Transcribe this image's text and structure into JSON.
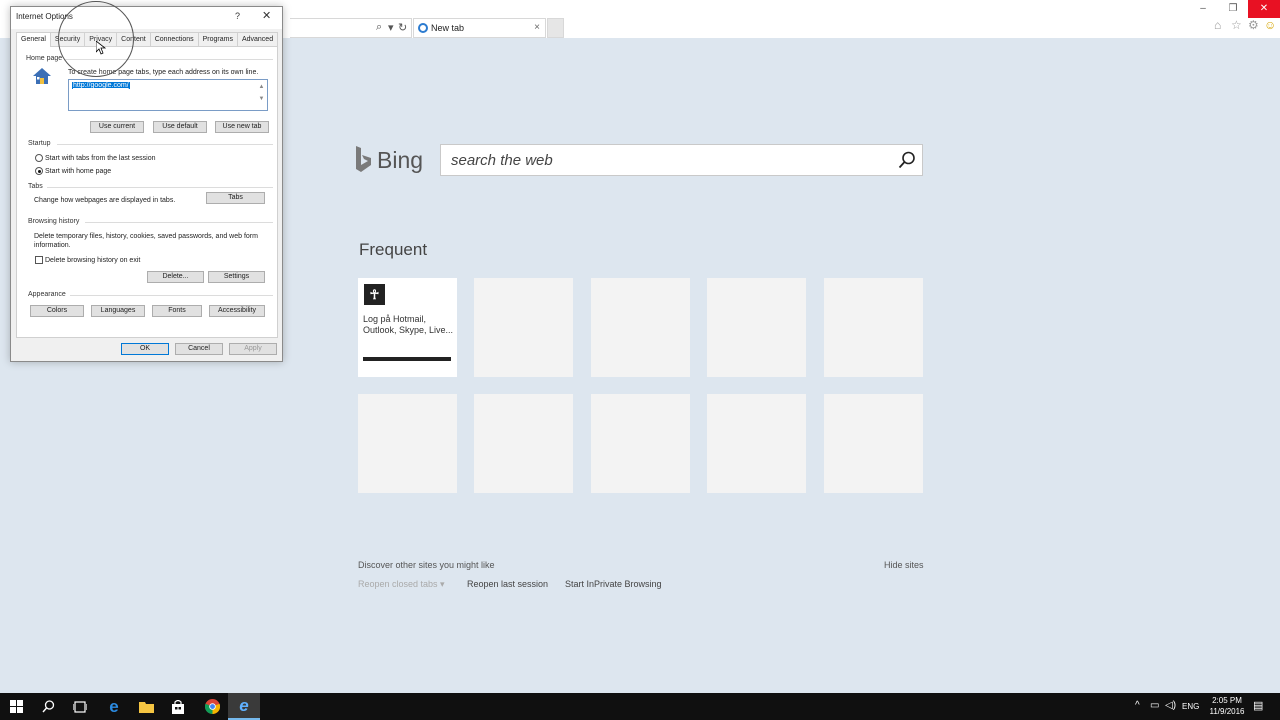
{
  "browser": {
    "tab_title": "New tab",
    "tab_close": "×",
    "window_controls": {
      "minimize": "–",
      "restore": "❐",
      "close": "✕"
    }
  },
  "bing": {
    "logo_text": "Bing",
    "search_placeholder": "search the web"
  },
  "frequent": {
    "title": "Frequent",
    "tiles": [
      {
        "label": "Log på Hotmail, Outlook, Skype, Live..."
      }
    ]
  },
  "footer": {
    "discover": "Discover other sites you might like",
    "hide_sites": "Hide sites",
    "reopen_closed": "Reopen closed tabs ▾",
    "reopen_last": "Reopen last session",
    "inprivate": "Start InPrivate Browsing"
  },
  "dialog": {
    "title": "Internet Options",
    "help": "?",
    "close": "✕",
    "tabs": [
      "General",
      "Security",
      "Privacy",
      "Content",
      "Connections",
      "Programs",
      "Advanced"
    ],
    "home_page": {
      "heading": "Home page",
      "instruction": "To create home page tabs, type each address on its own line.",
      "value": "http://google.com/",
      "buttons": {
        "use_current": "Use current",
        "use_default": "Use default",
        "use_new_tab": "Use new tab"
      }
    },
    "startup": {
      "heading": "Startup",
      "option_last_session": "Start with tabs from the last session",
      "option_home_page": "Start with home page",
      "selected": "home_page"
    },
    "tabs_section": {
      "heading": "Tabs",
      "description": "Change how webpages are displayed in tabs.",
      "button": "Tabs"
    },
    "browsing_history": {
      "heading": "Browsing history",
      "description": "Delete temporary files, history, cookies, saved passwords, and web form information.",
      "checkbox_label": "Delete browsing history on exit",
      "checkbox_checked": false,
      "delete_button": "Delete...",
      "settings_button": "Settings"
    },
    "appearance": {
      "heading": "Appearance",
      "buttons": {
        "colors": "Colors",
        "languages": "Languages",
        "fonts": "Fonts",
        "accessibility": "Accessibility"
      }
    },
    "footer_buttons": {
      "ok": "OK",
      "cancel": "Cancel",
      "apply": "Apply"
    }
  },
  "taskbar": {
    "language": "ENG",
    "time": "2:05 PM",
    "date": "11/9/2016"
  },
  "colors": {
    "page_bg": "#dde6ef",
    "accent": "#0078d7",
    "close_red": "#e81123"
  }
}
